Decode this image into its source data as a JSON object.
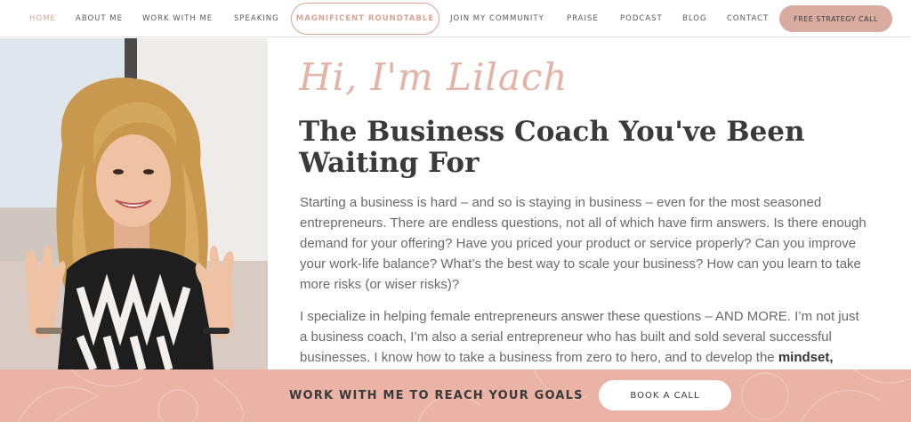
{
  "nav": {
    "items": [
      {
        "label": "HOME",
        "active": true
      },
      {
        "label": "ABOUT ME"
      },
      {
        "label": "WORK WITH ME"
      },
      {
        "label": "SPEAKING"
      },
      {
        "label": "MAGNIFICENT ROUNDTABLE"
      },
      {
        "label": "JOIN MY COMMUNITY"
      },
      {
        "label": "PRAISE"
      },
      {
        "label": "PODCAST"
      },
      {
        "label": "BLOG"
      },
      {
        "label": "CONTACT"
      }
    ],
    "cta_label": "FREE STRATEGY CALL"
  },
  "hero": {
    "greeting": "Hi, I'm Lilach",
    "headline_line1": "The Business Coach You've Been",
    "headline_line2": "Waiting For",
    "paragraph1": "Starting a business is hard – and so is staying in business – even for the most seasoned entrepreneurs. There are endless questions, not all of which have firm answers. Is there enough demand for your offering? Have you priced your product or service properly? Can you improve your work-life balance? What’s the best way to scale your business? How can you learn to take more risks (or wiser risks)?",
    "paragraph2": "I specialize in helping female entrepreneurs answer these questions – AND MORE. I’m not just a business coach, I’m also a serial entrepreneur who has built and sold several successful businesses. I know how to take a business from zero to hero, and to develop the",
    "paragraph2_bold": "mindset,"
  },
  "bottom_bar": {
    "text": "WORK WITH ME TO REACH YOUR GOALS",
    "button_label": "BOOK A CALL"
  },
  "colors": {
    "accent": "#d9a494",
    "cta_bg": "#d9aca1",
    "bottom_bar_bg": "#ebb3a6",
    "heading": "#3a3a3a"
  }
}
